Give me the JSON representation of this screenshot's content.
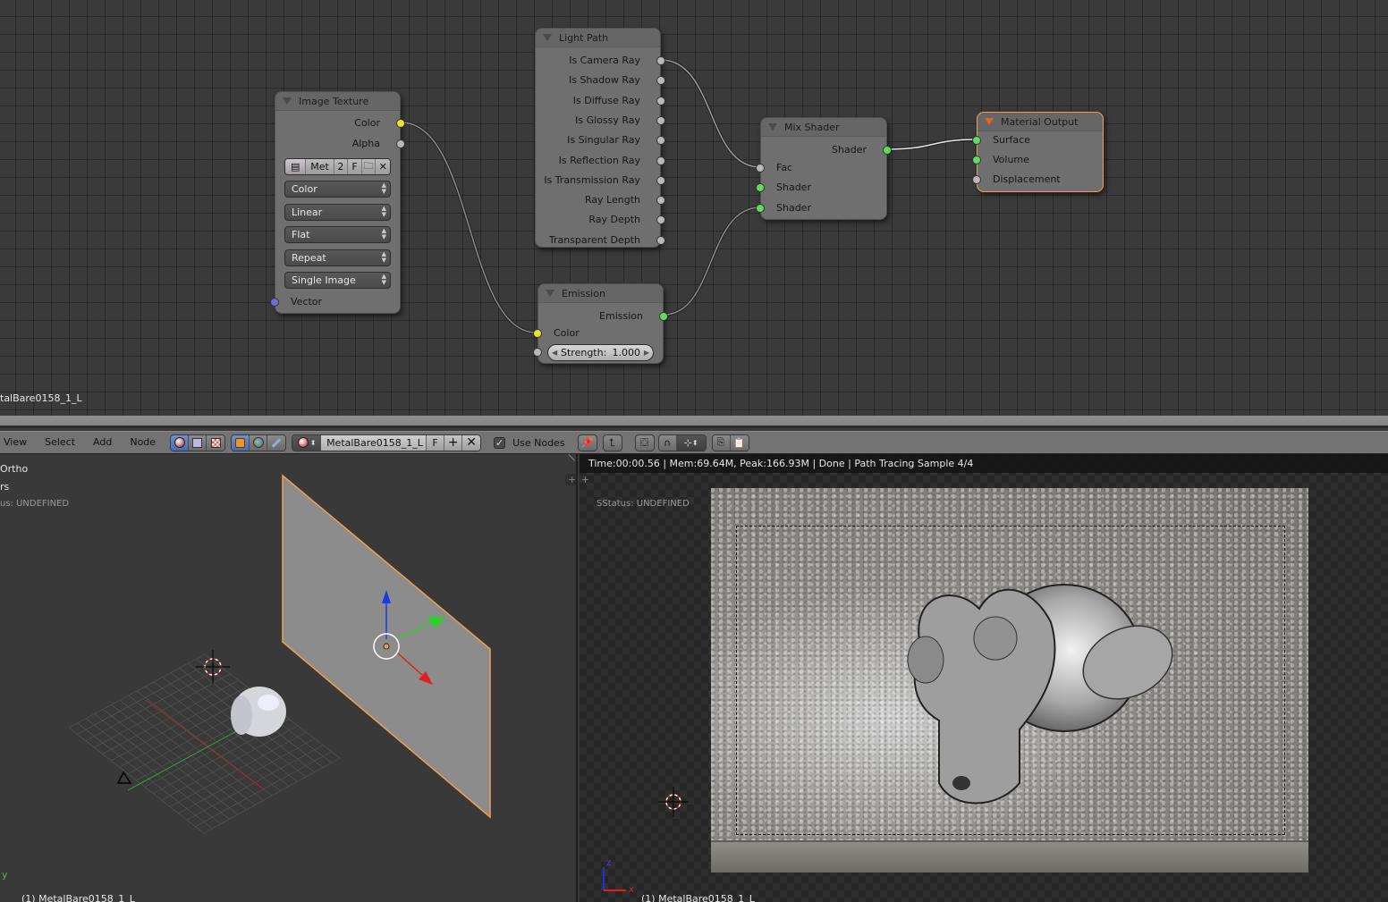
{
  "node_editor": {
    "material_name_overlay": "talBare0158_1_L",
    "nodes": {
      "image_texture": {
        "title": "Image Texture",
        "outputs": [
          "Color",
          "Alpha"
        ],
        "image_block": {
          "name": "Met",
          "users": "2",
          "fake_user": "F"
        },
        "dropdowns": [
          "Color",
          "Linear",
          "Flat",
          "Repeat",
          "Single Image"
        ],
        "inputs": [
          "Vector"
        ]
      },
      "light_path": {
        "title": "Light Path",
        "outputs": [
          "Is Camera Ray",
          "Is Shadow Ray",
          "Is Diffuse Ray",
          "Is Glossy Ray",
          "Is Singular Ray",
          "Is Reflection Ray",
          "Is Transmission Ray",
          "Ray Length",
          "Ray Depth",
          "Transparent Depth"
        ]
      },
      "emission": {
        "title": "Emission",
        "outputs": [
          "Emission"
        ],
        "inputs": [
          "Color"
        ],
        "strength_label": "Strength:",
        "strength_value": "1.000"
      },
      "mix_shader": {
        "title": "Mix Shader",
        "outputs": [
          "Shader"
        ],
        "inputs": [
          "Fac",
          "Shader",
          "Shader"
        ]
      },
      "material_output": {
        "title": "Material Output",
        "inputs": [
          "Surface",
          "Volume",
          "Displacement"
        ]
      }
    },
    "socket_colors": {
      "color": "#e6e62e",
      "value": "#b8b8b8",
      "shader": "#5fdd5f",
      "vector": "#6b6bde"
    },
    "accent_selected": "#f0a050"
  },
  "header": {
    "menus": [
      "View",
      "Select",
      "Add",
      "Node"
    ],
    "shader_type_icons": [
      "shader-icon",
      "compositing-icon",
      "texture-icon"
    ],
    "shader_source_icons": [
      "object-icon",
      "world-icon",
      "linestyle-icon"
    ],
    "material": {
      "name": "MetalBare0158_1_L",
      "fake_user": "F",
      "add": "+",
      "remove": "✕"
    },
    "use_nodes_checked": true,
    "use_nodes_label": "Use Nodes",
    "pin_icon": "📌",
    "parent_icon": "⮤",
    "snap_icon": "⊹"
  },
  "view3d": {
    "view_label": "Ortho",
    "layer_label": "rs",
    "status_label": "us: UNDEFINED",
    "object_label": "(1) MetalBare0158_1_L",
    "axis_label": "y"
  },
  "render_view": {
    "stats": "Time:00:00.56 | Mem:69.64M, Peak:166.93M | Done | Path Tracing Sample 4/4",
    "status_label": "SStatus: UNDEFINED",
    "object_label": "(1) MetalBare0158_1_L",
    "axis_z": "z",
    "axis_x": "x"
  }
}
